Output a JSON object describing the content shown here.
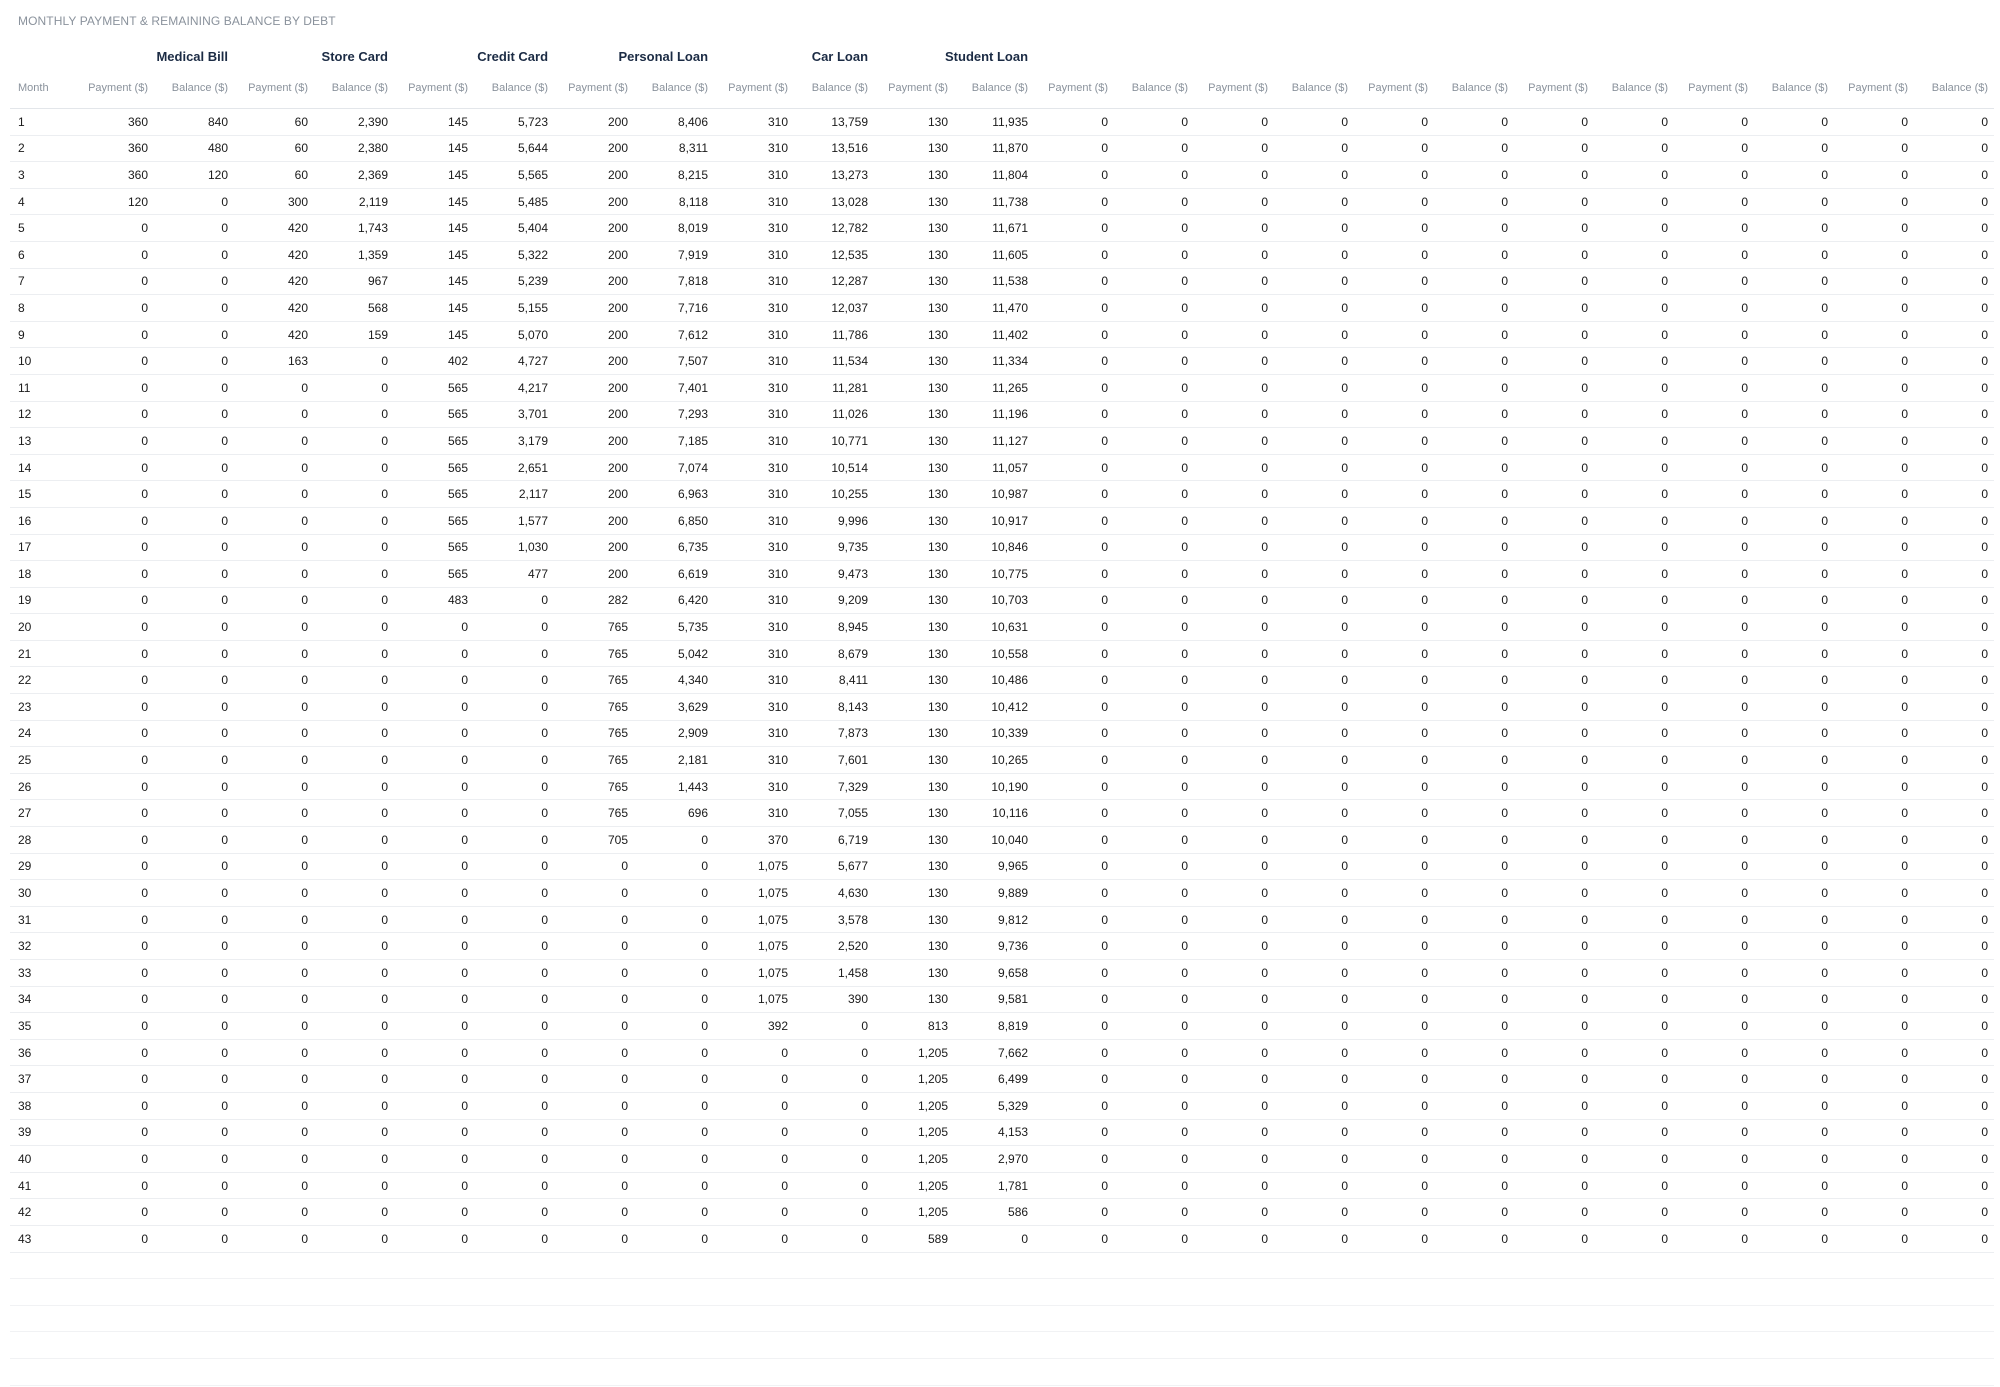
{
  "title": "MONTHLY PAYMENT & REMAINING BALANCE BY DEBT",
  "month_header": "Month",
  "payment_header": "Payment ($)",
  "balance_header": "Balance ($)",
  "debts": [
    "Medical Bill",
    "Store Card",
    "Credit Card",
    "Personal Loan",
    "Car Loan",
    "Student Loan",
    "",
    "",
    "",
    "",
    "",
    ""
  ],
  "rows": [
    [
      "1",
      "360",
      "840",
      "60",
      "2,390",
      "145",
      "5,723",
      "200",
      "8,406",
      "310",
      "13,759",
      "130",
      "11,935"
    ],
    [
      "2",
      "360",
      "480",
      "60",
      "2,380",
      "145",
      "5,644",
      "200",
      "8,311",
      "310",
      "13,516",
      "130",
      "11,870"
    ],
    [
      "3",
      "360",
      "120",
      "60",
      "2,369",
      "145",
      "5,565",
      "200",
      "8,215",
      "310",
      "13,273",
      "130",
      "11,804"
    ],
    [
      "4",
      "120",
      "0",
      "300",
      "2,119",
      "145",
      "5,485",
      "200",
      "8,118",
      "310",
      "13,028",
      "130",
      "11,738"
    ],
    [
      "5",
      "0",
      "0",
      "420",
      "1,743",
      "145",
      "5,404",
      "200",
      "8,019",
      "310",
      "12,782",
      "130",
      "11,671"
    ],
    [
      "6",
      "0",
      "0",
      "420",
      "1,359",
      "145",
      "5,322",
      "200",
      "7,919",
      "310",
      "12,535",
      "130",
      "11,605"
    ],
    [
      "7",
      "0",
      "0",
      "420",
      "967",
      "145",
      "5,239",
      "200",
      "7,818",
      "310",
      "12,287",
      "130",
      "11,538"
    ],
    [
      "8",
      "0",
      "0",
      "420",
      "568",
      "145",
      "5,155",
      "200",
      "7,716",
      "310",
      "12,037",
      "130",
      "11,470"
    ],
    [
      "9",
      "0",
      "0",
      "420",
      "159",
      "145",
      "5,070",
      "200",
      "7,612",
      "310",
      "11,786",
      "130",
      "11,402"
    ],
    [
      "10",
      "0",
      "0",
      "163",
      "0",
      "402",
      "4,727",
      "200",
      "7,507",
      "310",
      "11,534",
      "130",
      "11,334"
    ],
    [
      "11",
      "0",
      "0",
      "0",
      "0",
      "565",
      "4,217",
      "200",
      "7,401",
      "310",
      "11,281",
      "130",
      "11,265"
    ],
    [
      "12",
      "0",
      "0",
      "0",
      "0",
      "565",
      "3,701",
      "200",
      "7,293",
      "310",
      "11,026",
      "130",
      "11,196"
    ],
    [
      "13",
      "0",
      "0",
      "0",
      "0",
      "565",
      "3,179",
      "200",
      "7,185",
      "310",
      "10,771",
      "130",
      "11,127"
    ],
    [
      "14",
      "0",
      "0",
      "0",
      "0",
      "565",
      "2,651",
      "200",
      "7,074",
      "310",
      "10,514",
      "130",
      "11,057"
    ],
    [
      "15",
      "0",
      "0",
      "0",
      "0",
      "565",
      "2,117",
      "200",
      "6,963",
      "310",
      "10,255",
      "130",
      "10,987"
    ],
    [
      "16",
      "0",
      "0",
      "0",
      "0",
      "565",
      "1,577",
      "200",
      "6,850",
      "310",
      "9,996",
      "130",
      "10,917"
    ],
    [
      "17",
      "0",
      "0",
      "0",
      "0",
      "565",
      "1,030",
      "200",
      "6,735",
      "310",
      "9,735",
      "130",
      "10,846"
    ],
    [
      "18",
      "0",
      "0",
      "0",
      "0",
      "565",
      "477",
      "200",
      "6,619",
      "310",
      "9,473",
      "130",
      "10,775"
    ],
    [
      "19",
      "0",
      "0",
      "0",
      "0",
      "483",
      "0",
      "282",
      "6,420",
      "310",
      "9,209",
      "130",
      "10,703"
    ],
    [
      "20",
      "0",
      "0",
      "0",
      "0",
      "0",
      "0",
      "765",
      "5,735",
      "310",
      "8,945",
      "130",
      "10,631"
    ],
    [
      "21",
      "0",
      "0",
      "0",
      "0",
      "0",
      "0",
      "765",
      "5,042",
      "310",
      "8,679",
      "130",
      "10,558"
    ],
    [
      "22",
      "0",
      "0",
      "0",
      "0",
      "0",
      "0",
      "765",
      "4,340",
      "310",
      "8,411",
      "130",
      "10,486"
    ],
    [
      "23",
      "0",
      "0",
      "0",
      "0",
      "0",
      "0",
      "765",
      "3,629",
      "310",
      "8,143",
      "130",
      "10,412"
    ],
    [
      "24",
      "0",
      "0",
      "0",
      "0",
      "0",
      "0",
      "765",
      "2,909",
      "310",
      "7,873",
      "130",
      "10,339"
    ],
    [
      "25",
      "0",
      "0",
      "0",
      "0",
      "0",
      "0",
      "765",
      "2,181",
      "310",
      "7,601",
      "130",
      "10,265"
    ],
    [
      "26",
      "0",
      "0",
      "0",
      "0",
      "0",
      "0",
      "765",
      "1,443",
      "310",
      "7,329",
      "130",
      "10,190"
    ],
    [
      "27",
      "0",
      "0",
      "0",
      "0",
      "0",
      "0",
      "765",
      "696",
      "310",
      "7,055",
      "130",
      "10,116"
    ],
    [
      "28",
      "0",
      "0",
      "0",
      "0",
      "0",
      "0",
      "705",
      "0",
      "370",
      "6,719",
      "130",
      "10,040"
    ],
    [
      "29",
      "0",
      "0",
      "0",
      "0",
      "0",
      "0",
      "0",
      "0",
      "1,075",
      "5,677",
      "130",
      "9,965"
    ],
    [
      "30",
      "0",
      "0",
      "0",
      "0",
      "0",
      "0",
      "0",
      "0",
      "1,075",
      "4,630",
      "130",
      "9,889"
    ],
    [
      "31",
      "0",
      "0",
      "0",
      "0",
      "0",
      "0",
      "0",
      "0",
      "1,075",
      "3,578",
      "130",
      "9,812"
    ],
    [
      "32",
      "0",
      "0",
      "0",
      "0",
      "0",
      "0",
      "0",
      "0",
      "1,075",
      "2,520",
      "130",
      "9,736"
    ],
    [
      "33",
      "0",
      "0",
      "0",
      "0",
      "0",
      "0",
      "0",
      "0",
      "1,075",
      "1,458",
      "130",
      "9,658"
    ],
    [
      "34",
      "0",
      "0",
      "0",
      "0",
      "0",
      "0",
      "0",
      "0",
      "1,075",
      "390",
      "130",
      "9,581"
    ],
    [
      "35",
      "0",
      "0",
      "0",
      "0",
      "0",
      "0",
      "0",
      "0",
      "392",
      "0",
      "813",
      "8,819"
    ],
    [
      "36",
      "0",
      "0",
      "0",
      "0",
      "0",
      "0",
      "0",
      "0",
      "0",
      "0",
      "1,205",
      "7,662"
    ],
    [
      "37",
      "0",
      "0",
      "0",
      "0",
      "0",
      "0",
      "0",
      "0",
      "0",
      "0",
      "1,205",
      "6,499"
    ],
    [
      "38",
      "0",
      "0",
      "0",
      "0",
      "0",
      "0",
      "0",
      "0",
      "0",
      "0",
      "1,205",
      "5,329"
    ],
    [
      "39",
      "0",
      "0",
      "0",
      "0",
      "0",
      "0",
      "0",
      "0",
      "0",
      "0",
      "1,205",
      "4,153"
    ],
    [
      "40",
      "0",
      "0",
      "0",
      "0",
      "0",
      "0",
      "0",
      "0",
      "0",
      "0",
      "1,205",
      "2,970"
    ],
    [
      "41",
      "0",
      "0",
      "0",
      "0",
      "0",
      "0",
      "0",
      "0",
      "0",
      "0",
      "1,205",
      "1,781"
    ],
    [
      "42",
      "0",
      "0",
      "0",
      "0",
      "0",
      "0",
      "0",
      "0",
      "0",
      "0",
      "1,205",
      "586"
    ],
    [
      "43",
      "0",
      "0",
      "0",
      "0",
      "0",
      "0",
      "0",
      "0",
      "0",
      "0",
      "589",
      "0"
    ]
  ],
  "unused_debt_value": "0"
}
